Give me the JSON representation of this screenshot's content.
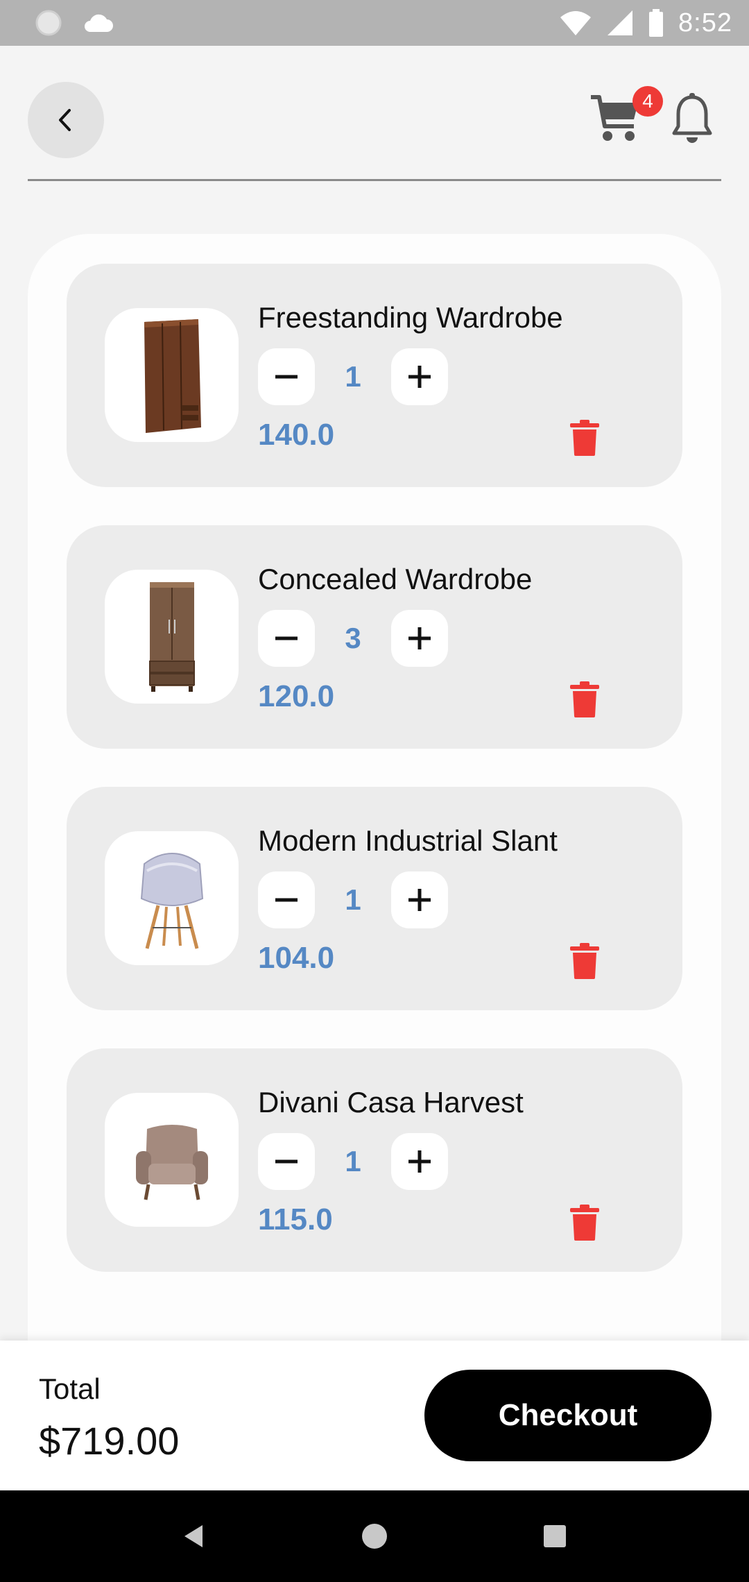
{
  "status_bar": {
    "time": "8:52",
    "icons": [
      "circle-indicator-icon",
      "cloud-icon",
      "wifi-icon",
      "cellular-signal-icon",
      "battery-icon"
    ]
  },
  "header": {
    "back_icon": "chevron-left-icon",
    "cart_icon": "shopping-cart-icon",
    "cart_badge_count": "4",
    "bell_icon": "bell-icon"
  },
  "cart": {
    "items": [
      {
        "name": "Freestanding Wardrobe",
        "quantity": "1",
        "price": "140.0",
        "image": "wardrobe-dark-image"
      },
      {
        "name": "Concealed Wardrobe",
        "quantity": "3",
        "price": "120.0",
        "image": "wardrobe-tall-image"
      },
      {
        "name": "Modern Industrial Slant",
        "quantity": "1",
        "price": "104.0",
        "image": "chair-shell-image"
      },
      {
        "name": "Divani Casa Harvest",
        "quantity": "1",
        "price": "115.0",
        "image": "armchair-image"
      }
    ]
  },
  "footer": {
    "total_label": "Total",
    "total_value": "$719.00",
    "checkout_label": "Checkout"
  },
  "colors": {
    "accent_blue": "#5588c4",
    "delete_red": "#ee3a36",
    "badge_red": "#ee3a36",
    "checkout_bg": "#000000"
  }
}
